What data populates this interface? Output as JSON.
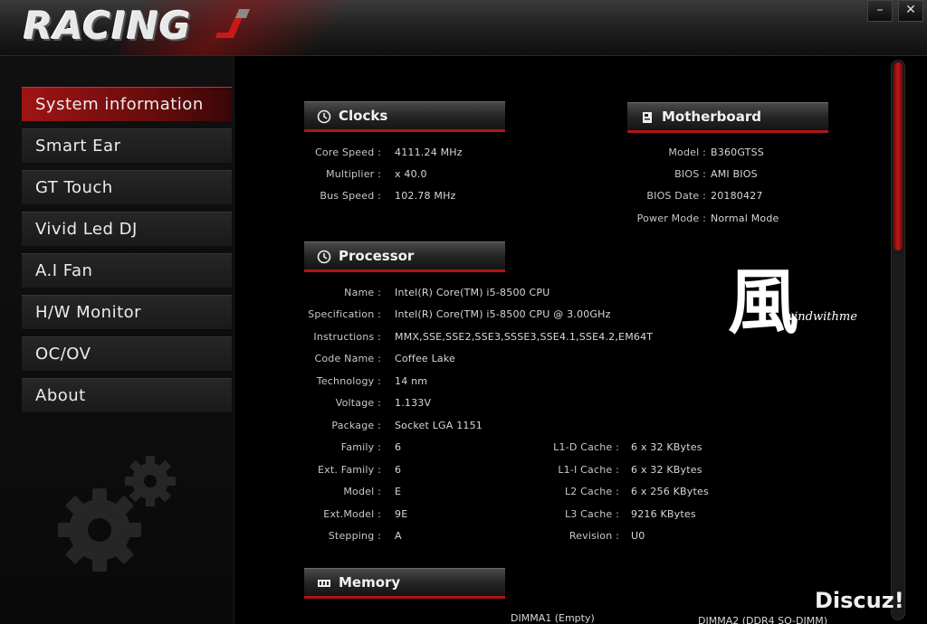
{
  "app": {
    "logo_text": "RACING",
    "minimize_glyph": "–",
    "close_glyph": "✕"
  },
  "sidebar": {
    "items": [
      {
        "label": "System information",
        "active": true
      },
      {
        "label": "Smart Ear"
      },
      {
        "label": "GT Touch"
      },
      {
        "label": "Vivid Led DJ"
      },
      {
        "label": "A.I Fan"
      },
      {
        "label": "H/W Monitor"
      },
      {
        "label": "OC/OV"
      },
      {
        "label": "About"
      }
    ]
  },
  "clocks": {
    "title": "Clocks",
    "icon": "clock-icon",
    "core_speed_label": "Core Speed :",
    "core_speed": "4111.24 MHz",
    "multiplier_label": "Multiplier :",
    "multiplier": "x 40.0",
    "bus_speed_label": "Bus Speed :",
    "bus_speed": "102.78 MHz"
  },
  "motherboard": {
    "title": "Motherboard",
    "icon": "motherboard-icon",
    "model_label": "Model :",
    "model": "B360GTSS",
    "bios_label": "BIOS :",
    "bios": "AMI BIOS",
    "bios_date_label": "BIOS Date :",
    "bios_date": "20180427",
    "power_mode_label": "Power Mode :",
    "power_mode": "Normal Mode"
  },
  "processor": {
    "title": "Processor",
    "icon": "clock-icon",
    "name_label": "Name :",
    "name": "Intel(R) Core(TM) i5-8500 CPU",
    "spec_label": "Specification :",
    "spec": "Intel(R) Core(TM) i5-8500 CPU @ 3.00GHz",
    "instructions_label": "Instructions :",
    "instructions": "MMX,SSE,SSE2,SSE3,SSSE3,SSE4.1,SSE4.2,EM64T",
    "code_name_label": "Code Name :",
    "code_name": "Coffee Lake",
    "technology_label": "Technology :",
    "technology": "14 nm",
    "voltage_label": "Voltage :",
    "voltage": "1.133V",
    "package_label": "Package :",
    "package": "Socket LGA 1151",
    "family_label": "Family :",
    "family": "6",
    "ext_family_label": "Ext. Family :",
    "ext_family": "6",
    "model_label": "Model :",
    "model": "E",
    "ext_model_label": "Ext.Model :",
    "ext_model": "9E",
    "stepping_label": "Stepping :",
    "stepping": "A",
    "l1d_label": "L1-D Cache :",
    "l1d": "6 x 32 KBytes",
    "l1i_label": "L1-I Cache :",
    "l1i": "6 x 32 KBytes",
    "l2_label": "L2 Cache :",
    "l2": "6 x 256 KBytes",
    "l3_label": "L3 Cache :",
    "l3": "9216 KBytes",
    "revision_label": "Revision :",
    "revision": "U0"
  },
  "memory": {
    "title": "Memory",
    "icon": "memory-icon",
    "dimm1": "DIMMA1 (Empty)",
    "dimm2": "DIMMA2 (DDR4 SO-DIMM)"
  },
  "watermark": {
    "char": "風",
    "text": "windwithme",
    "site": "Discuz!"
  }
}
